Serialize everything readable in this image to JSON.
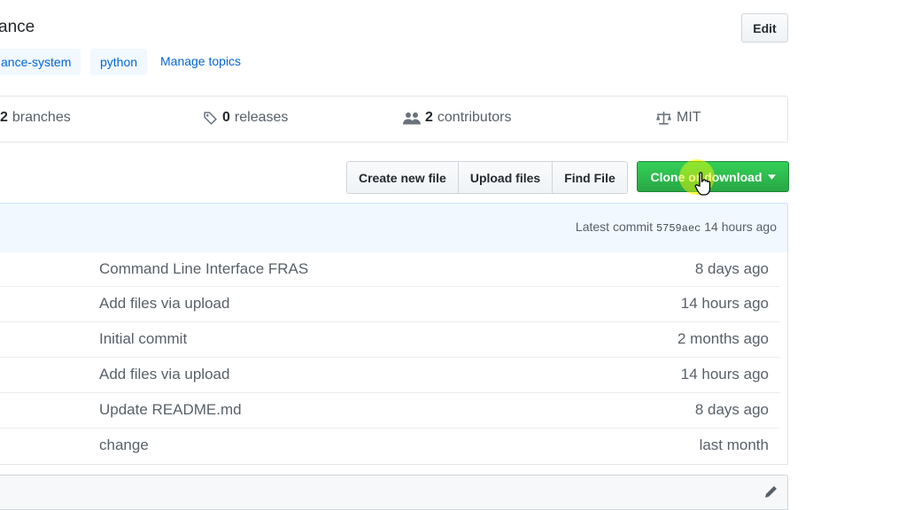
{
  "repo": {
    "description_fragment": "ance",
    "edit_label": "Edit"
  },
  "topics": {
    "items": [
      "ance-system",
      "python"
    ],
    "manage_label": "Manage topics"
  },
  "summary": {
    "branches_count": "2",
    "branches_label": "branches",
    "releases_count": "0",
    "releases_label": "releases",
    "contributors_count": "2",
    "contributors_label": "contributors",
    "license_label": "MIT"
  },
  "file_nav": {
    "create_label": "Create new file",
    "upload_label": "Upload files",
    "find_label": "Find File",
    "clone_label": "Clone or download"
  },
  "commit_tease": {
    "prefix": "Latest commit",
    "sha": "5759aec",
    "age": "14 hours ago"
  },
  "files": [
    {
      "message": "Command Line Interface FRAS",
      "age": "8 days ago"
    },
    {
      "message": "Add files via upload",
      "age": "14 hours ago"
    },
    {
      "message": "Initial commit",
      "age": "2 months ago"
    },
    {
      "message": "Add files via upload",
      "age": "14 hours ago"
    },
    {
      "message": "Update README.md",
      "age": "8 days ago"
    },
    {
      "message": "change",
      "age": "last month"
    }
  ],
  "icons": {
    "releases": "tag-icon",
    "contributors": "people-icon",
    "license": "law-icon",
    "clone_caret": "triangle-down-icon",
    "readme_edit": "pencil-icon"
  },
  "colors": {
    "link": "#0366d6",
    "topic_bg": "#f1f8ff",
    "clone_green": "#28a745",
    "commit_bg": "#f1f8ff"
  }
}
